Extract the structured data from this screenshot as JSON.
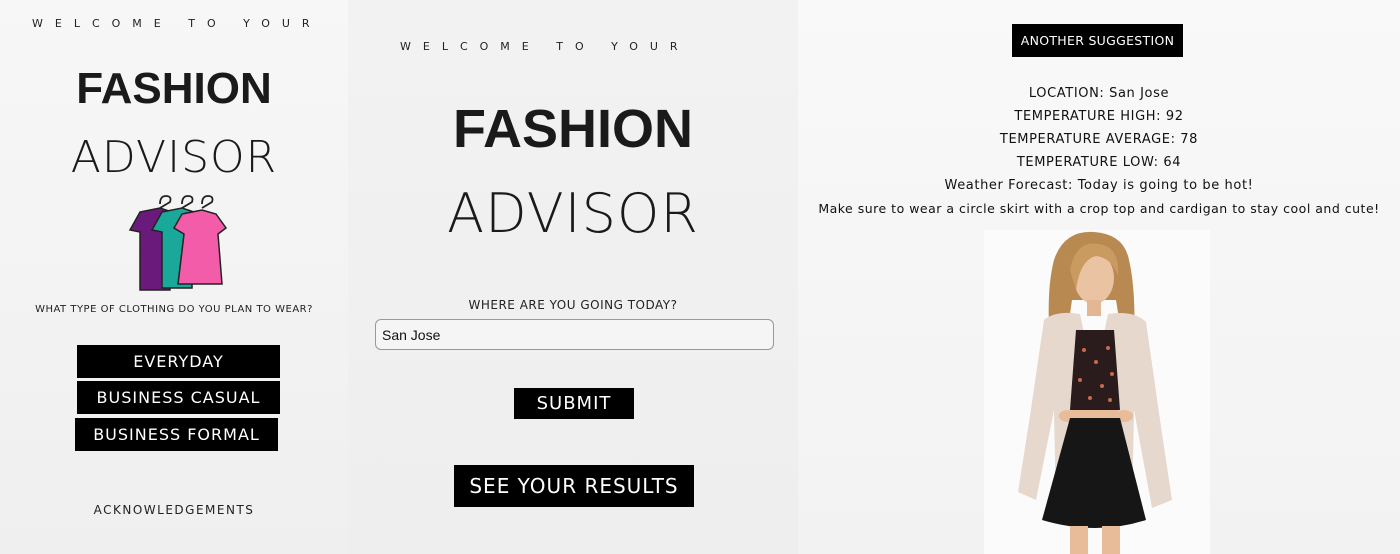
{
  "panel1": {
    "welcome": "WELCOME TO YOUR",
    "title_line1": "FASHION",
    "title_line2": "ADVISOR",
    "question": "WHAT TYPE OF CLOTHING DO YOU PLAN TO WEAR?",
    "buttons": [
      "EVERYDAY",
      "BUSINESS CASUAL",
      "BUSINESS FORMAL"
    ],
    "acknowledgements": "ACKNOWLEDGEMENTS",
    "shirt_colors": [
      "#6a1a7a",
      "#1aa89a",
      "#f25ca8"
    ]
  },
  "panel2": {
    "welcome": "WELCOME TO YOUR",
    "title_line1": "FASHION",
    "title_line2": "ADVISOR",
    "question": "WHERE ARE YOU GOING TODAY?",
    "location_value": "San Jose",
    "submit": "SUBMIT",
    "see_results": "SEE YOUR RESULTS"
  },
  "panel3": {
    "another_suggestion": "ANOTHER SUGGESTION",
    "location": "LOCATION: San Jose",
    "temp_high": "TEMPERATURE HIGH: 92",
    "temp_avg": "TEMPERATURE AVERAGE: 78",
    "temp_low": "TEMPERATURE LOW: 64",
    "forecast": "Weather Forecast: Today is going to be hot!",
    "suggestion": "Make sure to wear a circle skirt with a crop top and cardigan to stay cool and cute!"
  }
}
